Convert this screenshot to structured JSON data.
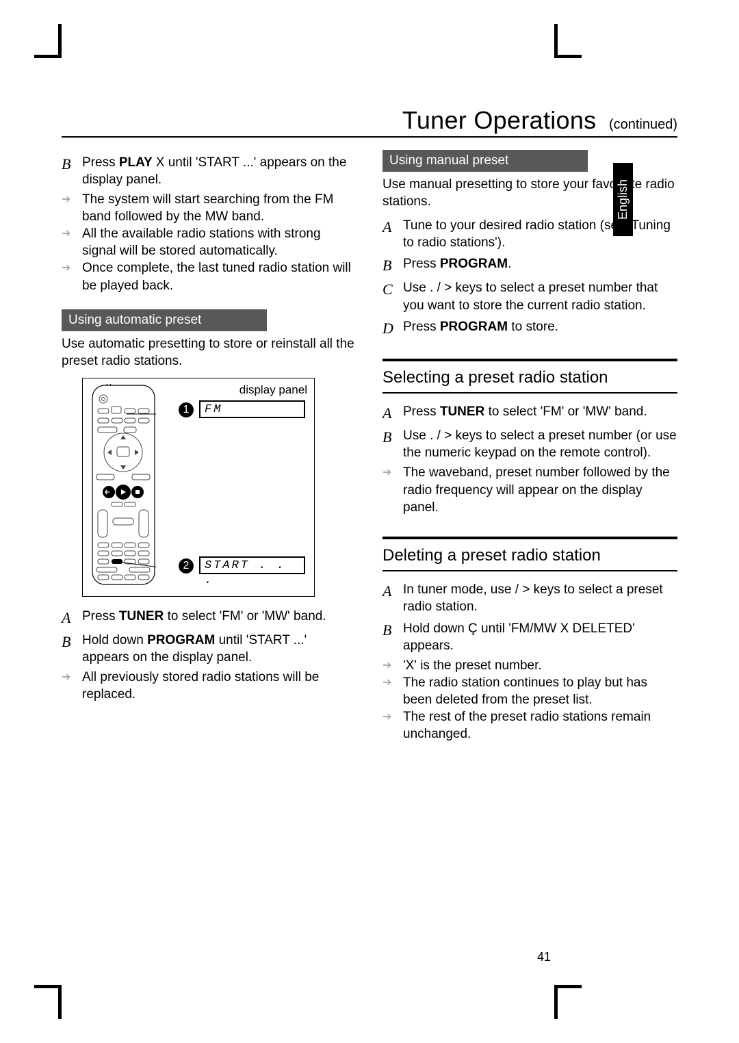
{
  "header": {
    "title": "Tuner Operations",
    "continued": "(continued)"
  },
  "language_tab": "English",
  "page_number": "41",
  "left": {
    "stepB": {
      "letter": "B",
      "line1a": "Press ",
      "line1b": "PLAY ",
      "line1c": "X",
      "line1d": " until 'START ...' appears on the display panel.",
      "arrow1": "The system will start searching from the FM band followed by the MW band.",
      "arrow2": "All the available radio stations with strong signal will be stored automatically.",
      "arrow3": "Once complete, the last tuned radio station will be played back."
    },
    "auto_box_title": "Using automatic preset",
    "auto_intro": "Use automatic presetting to store or reinstall all the preset radio stations.",
    "figure": {
      "display_panel_label": "display panel",
      "lcd1": "FM",
      "lcd2": "START . . .",
      "num1": "1",
      "num2": "2"
    },
    "stepA2": {
      "letter": "A",
      "text_a": "Press ",
      "text_b": "TUNER",
      "text_c": " to select 'FM' or 'MW' band."
    },
    "stepB2": {
      "letter": "B",
      "line1a": "Hold down ",
      "line1b": "PROGRAM",
      "line1c": " until 'START ...' appears on the display panel.",
      "arrow1": "All previously stored radio stations will be replaced."
    }
  },
  "right": {
    "manual_box_title": "Using manual preset",
    "manual_intro": "Use manual presetting to store your favourite radio stations.",
    "mA": {
      "letter": "A",
      "text": "Tune to your desired radio station (see 'Tuning to radio stations')."
    },
    "mB": {
      "letter": "B",
      "pre": "Press ",
      "b": "PROGRAM",
      "post": "."
    },
    "mC": {
      "letter": "C",
      "text": "Use .     / >     keys to select a preset number that you want to store the current radio station."
    },
    "mD": {
      "letter": "D",
      "pre": "Press ",
      "b": "PROGRAM",
      "post": " to store."
    },
    "sel_title": "Selecting a preset radio station",
    "sA": {
      "letter": "A",
      "pre": "Press ",
      "b": "TUNER",
      "post": " to select 'FM' or 'MW' band."
    },
    "sB": {
      "letter": "B",
      "line": "Use .     / >     keys to select a preset number (or use the numeric keypad on the remote control).",
      "arrow": "The waveband, preset number followed by the radio frequency will appear on the display panel."
    },
    "del_title": "Deleting a preset radio station",
    "dA": {
      "letter": "A",
      "text": "In tuner mode, use      / >     keys to select a preset radio station."
    },
    "dB": {
      "letter": "B",
      "line": "Hold down Ç  until 'FM/MW X DELETED' appears.",
      "arrow1": "'X' is the preset number.",
      "arrow2": "The radio station continues to play but has been deleted from the preset list.",
      "arrow3": "The rest of the preset radio stations remain unchanged."
    }
  }
}
